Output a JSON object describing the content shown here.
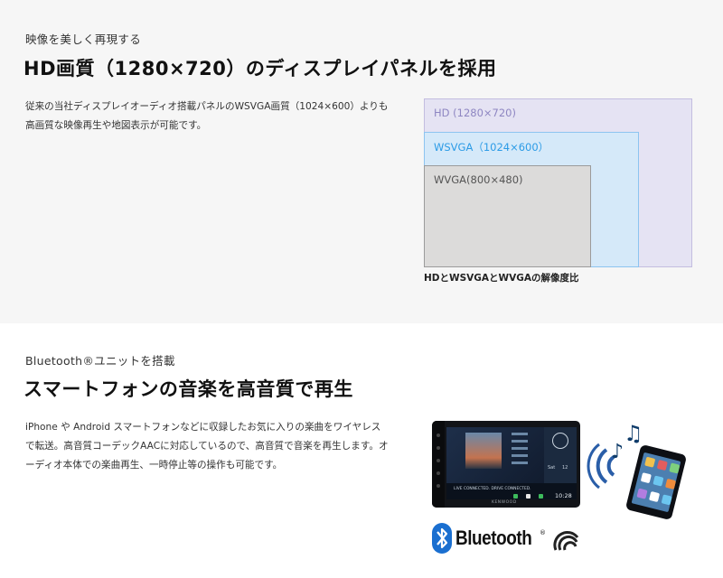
{
  "display_section": {
    "eyebrow": "映像を美しく再現する",
    "heading": "HD画質（1280×720）のディスプレイパネルを採用",
    "body_lines": [
      "従来の当社ディスプレイオーディオ搭載パネルのWSVGA画質（1024×600）よりも",
      "高画質な映像再生や地図表示が可能です。"
    ],
    "resolution_boxes": [
      {
        "label": "HD (1280×720)",
        "color": "#8e86c2"
      },
      {
        "label": "WSVGA（1024×600）",
        "color": "#2b9be6"
      },
      {
        "label": "WVGA(800×480)",
        "color": "#555555"
      }
    ],
    "caption": "HDとWSVGAとWVGAの解像度比"
  },
  "bluetooth_section": {
    "eyebrow": "Bluetooth®ユニットを搭載",
    "heading": "スマートフォンの音楽を高音質で再生",
    "body_lines": [
      "iPhone や Android スマートフォンなどに収録したお気に入りの楽曲をワイヤレス",
      "で転送。高音質コーデックAACに対応しているので、高音質で音楽を再生します。オ",
      "ーディオ本体での楽曲再生、一時停止等の操作も可能です。"
    ],
    "device": {
      "status_text": "LIVE CONNECTED.  DRIVE CONNECTED.",
      "time": "10:28",
      "day": "Sat",
      "date": "12",
      "brand": "KENWOOD"
    },
    "logo_text": "Bluetooth",
    "logo_mark": "®"
  },
  "colors": {
    "top_background": "#f6f6f6",
    "hd_fill": "#e5e3f3",
    "wsvga_fill": "#d5e9f9",
    "wvga_fill": "#dcdbda",
    "bluetooth_blue": "#1a6fd0"
  },
  "icons": [
    "bluetooth-icon",
    "aac-codec-icon",
    "signal-waves-icon",
    "music-note-icon"
  ]
}
